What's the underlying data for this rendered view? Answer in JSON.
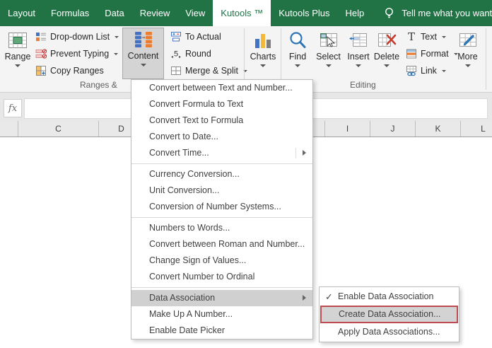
{
  "colors": {
    "excel_green": "#217346",
    "ribbon_bg": "#f4f4f4",
    "pressed_bg": "#d4d4d4",
    "menu_highlight": "#d0d0d0",
    "red_outline": "#bd4b4f"
  },
  "tabbar": {
    "tabs": [
      {
        "label": "Layout",
        "active": false
      },
      {
        "label": "Formulas",
        "active": false
      },
      {
        "label": "Data",
        "active": false
      },
      {
        "label": "Review",
        "active": false
      },
      {
        "label": "View",
        "active": false
      },
      {
        "label": "Kutools ™",
        "active": true
      },
      {
        "label": "Kutools Plus",
        "active": false
      },
      {
        "label": "Help",
        "active": false
      }
    ],
    "tell_me": "Tell me what you want to"
  },
  "ribbon": {
    "buttons": {
      "range": "Range",
      "dropdown_list": "Drop-down List",
      "prevent_typing": "Prevent Typing",
      "copy_ranges": "Copy Ranges",
      "content": "Content",
      "to_actual": "To Actual",
      "round": "Round",
      "merge_split": "Merge & Split",
      "charts": "Charts",
      "find": "Find",
      "select": "Select",
      "insert": "Insert",
      "delete": "Delete",
      "text": "Text",
      "format": "Format",
      "link": "Link",
      "more": "More"
    },
    "groups": {
      "ranges": "Ranges &",
      "editing": "Editing"
    }
  },
  "formula_bar": {
    "fx_label": "fx",
    "input_value": ""
  },
  "column_headers": [
    "",
    "C",
    "D",
    "",
    "",
    "",
    "",
    "I",
    "J",
    "K",
    "L"
  ],
  "menu": {
    "items": [
      {
        "label": "Convert between Text and Number..."
      },
      {
        "label": "Convert Formula to Text"
      },
      {
        "label": "Convert Text to Formula"
      },
      {
        "label": "Convert to Date..."
      },
      {
        "label": "Convert Time...",
        "has_submenu": true
      },
      {
        "type": "separator"
      },
      {
        "label": "Currency Conversion..."
      },
      {
        "label": "Unit Conversion..."
      },
      {
        "label": "Conversion of Number Systems..."
      },
      {
        "type": "separator"
      },
      {
        "label": "Numbers to Words..."
      },
      {
        "label": "Convert between Roman and Number..."
      },
      {
        "label": "Change Sign of Values..."
      },
      {
        "label": "Convert Number to Ordinal"
      },
      {
        "type": "separator"
      },
      {
        "label": "Data Association",
        "has_submenu": true,
        "highlighted": true
      },
      {
        "label": "Make Up A Number..."
      },
      {
        "label": "Enable Date Picker"
      }
    ]
  },
  "submenu": {
    "items": [
      {
        "label": "Enable Data Association",
        "check": "✓"
      },
      {
        "label": "Create Data Association...",
        "highlighted": true,
        "red_outline": true
      },
      {
        "label": "Apply Data Associations..."
      }
    ]
  }
}
